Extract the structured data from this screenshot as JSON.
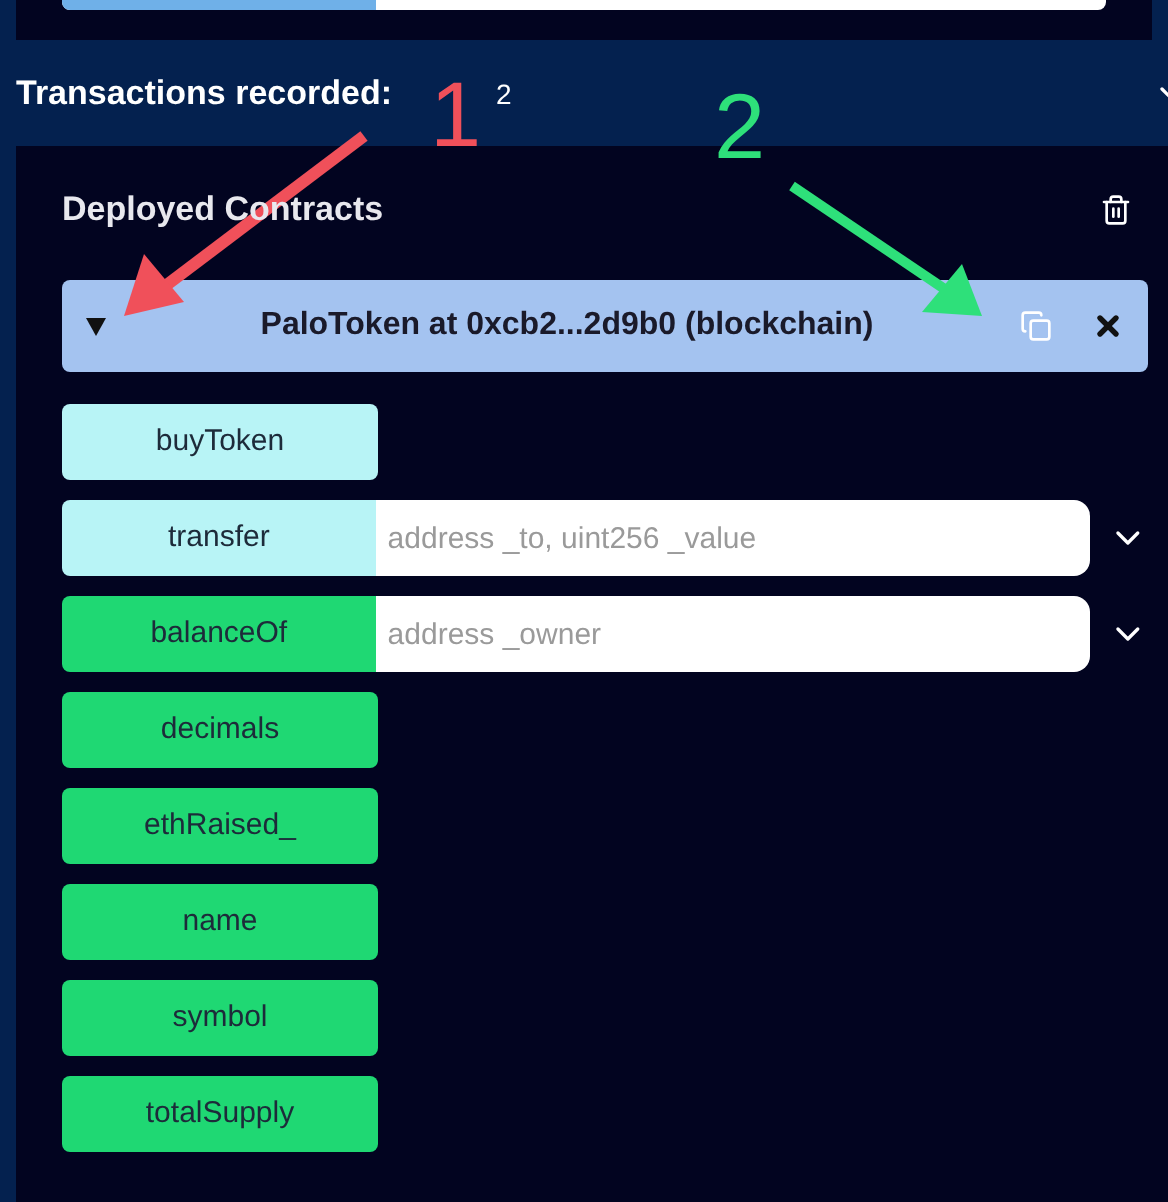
{
  "progress": {
    "level": 0.3
  },
  "section": {
    "title": "Transactions recorded:",
    "count": "2",
    "expanded": true
  },
  "deployed": {
    "title": "Deployed Contracts"
  },
  "instance": {
    "title": "PaloToken at 0xcb2...2d9b0 (blockchain)",
    "expanded": true
  },
  "functions": [
    {
      "name": "buyToken",
      "kind": "payable"
    },
    {
      "name": "transfer",
      "kind": "payable",
      "placeholder": "address _to, uint256 _value"
    },
    {
      "name": "balanceOf",
      "kind": "call",
      "placeholder": "address _owner"
    },
    {
      "name": "decimals",
      "kind": "call"
    },
    {
      "name": "ethRaised_",
      "kind": "call"
    },
    {
      "name": "name",
      "kind": "call"
    },
    {
      "name": "symbol",
      "kind": "call"
    },
    {
      "name": "totalSupply",
      "kind": "call"
    }
  ],
  "annotations": [
    {
      "label": "1",
      "color": "#f0505a"
    },
    {
      "label": "2",
      "color": "#2ee07a"
    }
  ]
}
